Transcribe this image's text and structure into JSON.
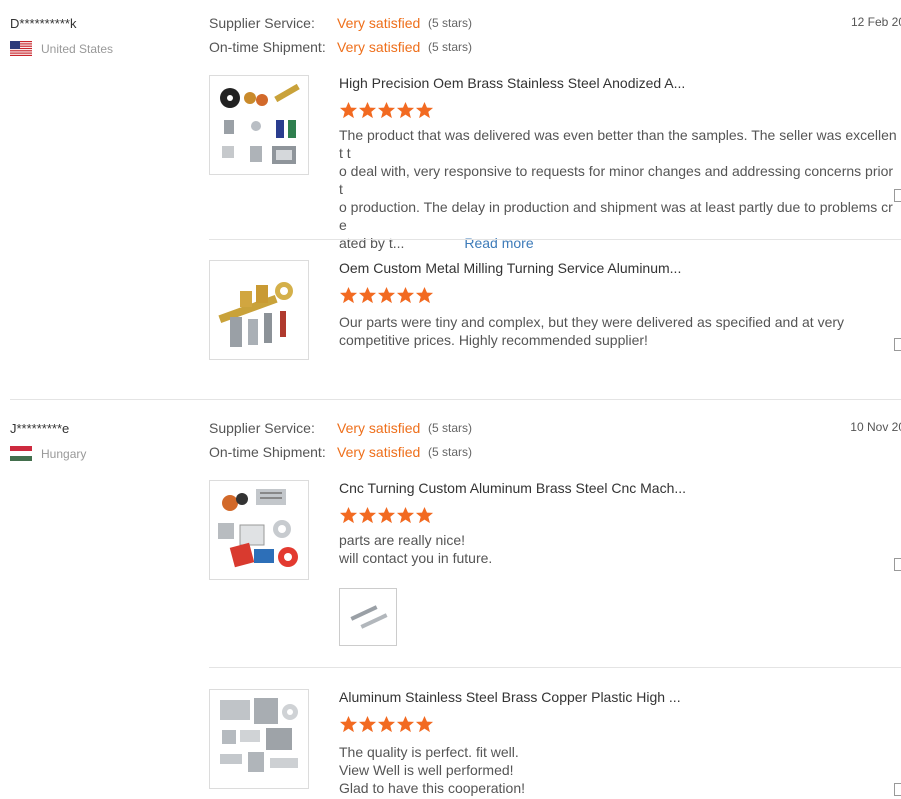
{
  "reviews": [
    {
      "name": "D**********k",
      "country": "United States",
      "flag_icon": "us-flag-icon",
      "date": "12 Feb 20",
      "supplier_service_label": "Supplier Service:",
      "supplier_service_value": "Very satisfied",
      "supplier_service_stars": "(5 stars)",
      "shipment_label": "On-time Shipment:",
      "shipment_value": "Very satisfied",
      "shipment_stars": "(5 stars)",
      "products": [
        {
          "title": "High Precision Oem Brass Stainless Steel Anodized A...",
          "rating": 5,
          "text_lines": [
            "The product that was delivered was even better than the samples. The seller was excellent t",
            "o deal with, very responsive to requests for minor changes and addressing concerns prior t",
            "o production. The delay in production and shipment was at least partly due to problems cre",
            "ated by t..."
          ],
          "read_more": "Read more"
        },
        {
          "title": "Oem Custom Metal Milling Turning Service Aluminum...",
          "rating": 5,
          "text_lines": [
            "Our parts were tiny and complex, but they were delivered as specified and at very",
            "competitive prices. Highly recommended supplier!"
          ]
        }
      ]
    },
    {
      "name": "J*********e",
      "country": "Hungary",
      "flag_icon": "hungary-flag-icon",
      "date": "10 Nov 20",
      "supplier_service_label": "Supplier Service:",
      "supplier_service_value": "Very satisfied",
      "supplier_service_stars": "(5 stars)",
      "shipment_label": "On-time Shipment:",
      "shipment_value": "Very satisfied",
      "shipment_stars": "(5 stars)",
      "products": [
        {
          "title": "Cnc Turning Custom Aluminum Brass Steel Cnc Mach...",
          "rating": 5,
          "text_lines": [
            "parts are really nice!",
            "will contact you in future."
          ]
        },
        {
          "title": "Aluminum Stainless Steel Brass Copper Plastic High ...",
          "rating": 5,
          "text_lines": [
            "The quality is perfect. fit well.",
            "View Well is well performed!",
            "Glad to have this cooperation!"
          ]
        }
      ]
    }
  ],
  "colors": {
    "accent_orange": "#ee6f1b",
    "star_orange": "#f26a21",
    "link_blue": "#3d7bb9"
  }
}
